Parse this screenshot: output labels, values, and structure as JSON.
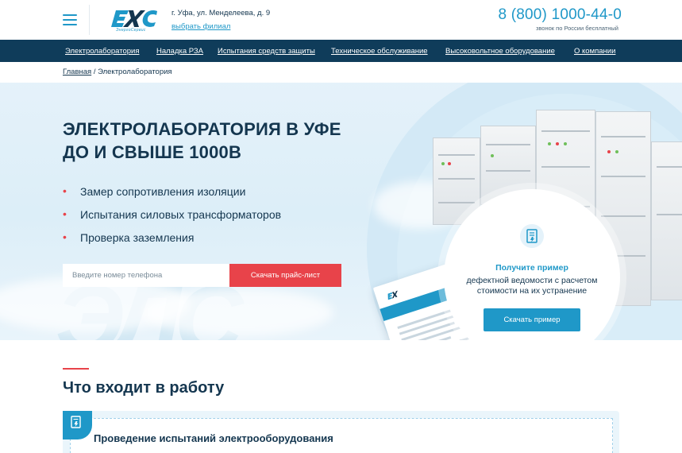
{
  "header": {
    "logo_tagline": "ЭнергоСервис",
    "address": "г. Уфа, ул. Менделеева, д. 9",
    "branch_link": "выбрать филиал",
    "phone": "8 (800) 1000-44-0",
    "phone_note": "звонок по России бесплатный"
  },
  "nav": {
    "items": [
      {
        "label": "Электролаборатория"
      },
      {
        "label": "Наладка РЗА"
      },
      {
        "label": "Испытания средств защиты"
      },
      {
        "label": "Техническое обслуживание"
      },
      {
        "label": "Высоковольтное оборудование"
      },
      {
        "label": "О компании"
      }
    ]
  },
  "breadcrumb": {
    "home": "Главная",
    "separator": "/",
    "current": "Электролаборатория"
  },
  "hero": {
    "title_line1": "ЭЛЕКТРОЛАБОРАТОРИЯ В УФЕ",
    "title_line2": "ДО И СВЫШЕ 1000В",
    "bullets": [
      "Замер сопротивления изоляции",
      "Испытания силовых трансформаторов",
      "Проверка заземления"
    ],
    "phone_placeholder": "Введите номер телефона",
    "price_button": "Скачать прайс-лист"
  },
  "sample": {
    "title": "Получите пример",
    "text": "дефектной ведомости с расчетом стоимости на их устранение",
    "button": "Скачать пример"
  },
  "section": {
    "title": "Что входит в работу",
    "card_title": "Проведение испытаний электрооборудования"
  },
  "colors": {
    "brand_blue": "#1f98c8",
    "nav_dark": "#0f3c5a",
    "accent_red": "#e8434a",
    "text_dark": "#14364f"
  },
  "icons": {
    "menu": "hamburger-menu-icon",
    "logo": "energoservis-logo",
    "sample": "document-icon",
    "card": "document-icon"
  }
}
